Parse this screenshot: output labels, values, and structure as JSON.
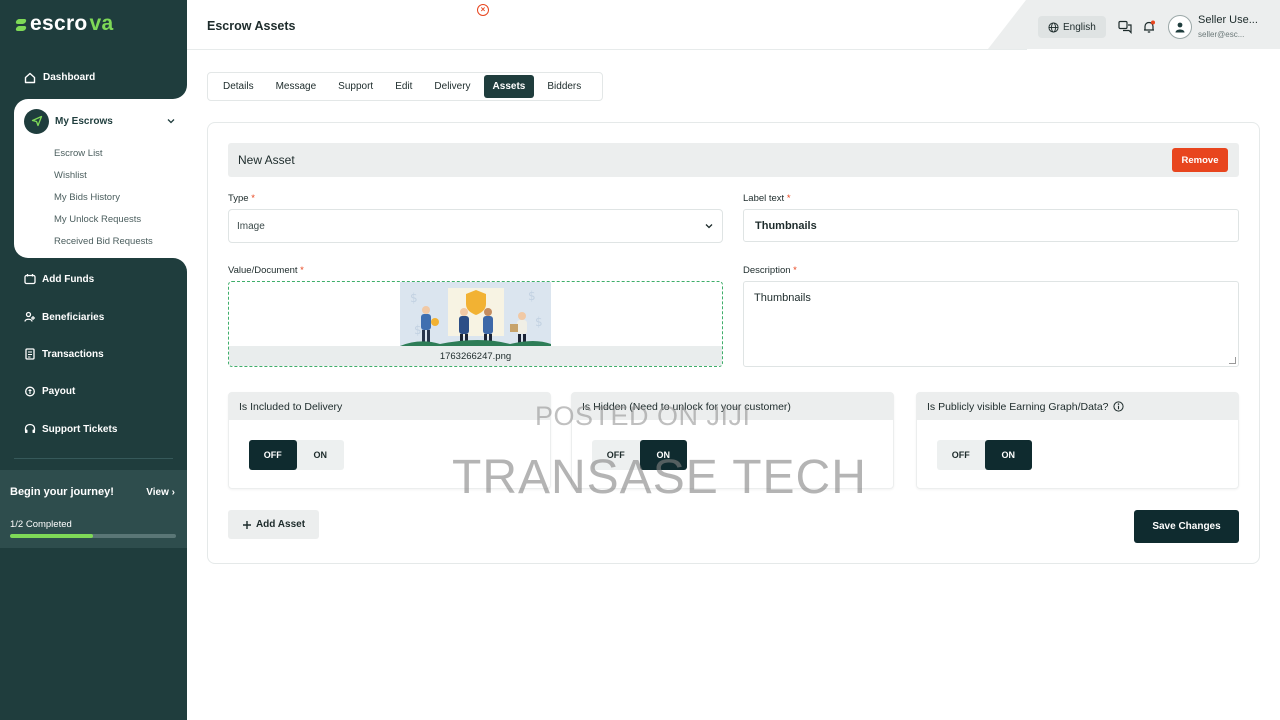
{
  "brand": {
    "logo_main": "escro",
    "logo_accent": "va"
  },
  "sidebar": {
    "dashboard": "Dashboard",
    "my_escrows": "My Escrows",
    "sub_items": [
      "Escrow List",
      "Wishlist",
      "My Bids History",
      "My Unlock Requests",
      "Received Bid Requests"
    ],
    "items": [
      {
        "label": "Add Funds",
        "icon": "wallet-icon"
      },
      {
        "label": "Beneficiaries",
        "icon": "users-icon"
      },
      {
        "label": "Transactions",
        "icon": "receipt-icon"
      },
      {
        "label": "Payout",
        "icon": "payout-icon"
      },
      {
        "label": "Support Tickets",
        "icon": "headset-icon"
      }
    ],
    "journey": {
      "title": "Begin your journey!",
      "view": "View",
      "completed": "1/2 Completed",
      "progress": 0.5
    }
  },
  "header": {
    "title": "Escrow Assets",
    "language": "English",
    "user_name": "Seller Use...",
    "user_email": "seller@esc..."
  },
  "tabs": [
    "Details",
    "Message",
    "Support",
    "Edit",
    "Delivery",
    "Assets",
    "Bidders"
  ],
  "active_tab": "Assets",
  "asset": {
    "section_title": "New Asset",
    "remove_label": "Remove",
    "type_label": "Type",
    "type_value": "Image",
    "label_text_label": "Label text",
    "label_text_value": "Thumbnails",
    "value_label": "Value/Document",
    "file_name": "1763266247.png",
    "description_label": "Description",
    "description_value": "Thumbnails",
    "required_marker": "*"
  },
  "toggles": [
    {
      "title": "Is Included to Delivery",
      "off": "OFF",
      "on": "ON",
      "state": "OFF"
    },
    {
      "title": "Is Hidden (Need to unlock for your customer)",
      "off": "OFF",
      "on": "ON",
      "state": "ON"
    },
    {
      "title": "Is Publicly visible Earning Graph/Data?",
      "off": "OFF",
      "on": "ON",
      "state": "ON"
    }
  ],
  "actions": {
    "add_asset": "Add Asset",
    "save_changes": "Save Changes"
  },
  "watermark": {
    "line1": "POSTED ON JIJI",
    "line2": "TRANSASE TECH"
  },
  "colors": {
    "sidebar": "#1f3d3d",
    "accent_green": "#7ed957",
    "danger": "#e8451e",
    "primary_dark": "#0f2b2f"
  }
}
